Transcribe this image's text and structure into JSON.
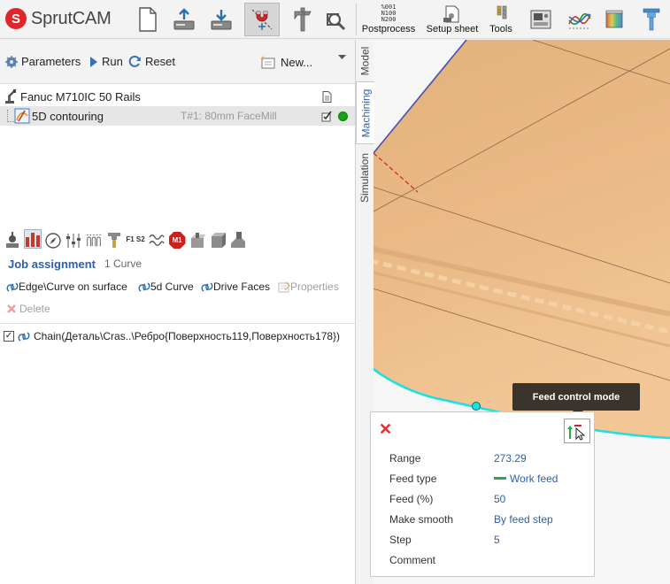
{
  "app": {
    "logo_letter": "S",
    "logo_text": "SprutCAM",
    "brand_color": "#e0262b"
  },
  "toolbar": {
    "postprocess_label": "Postprocess",
    "postprocess_icon_text": [
      "%001",
      "N100",
      "N200"
    ],
    "setup_sheet_label": "Setup sheet",
    "tools_label": "Tools"
  },
  "actions": {
    "parameters": "Parameters",
    "run": "Run",
    "reset": "Reset",
    "new": "New..."
  },
  "tree": {
    "machine": "Fanuc M710IC 50 Rails",
    "operation": "5D contouring",
    "operation_tool": "T#1: 80mm FaceMill",
    "operation_status_color": "#1aa31a"
  },
  "iconstrip": {
    "m1_label": "M1",
    "f1s2_label": "F1 S2"
  },
  "job": {
    "title": "Job assignment",
    "count": "1 Curve",
    "edge_curve": "Edge\\Curve on surface",
    "curve_5d": "5d Curve",
    "drive_faces": "Drive Faces",
    "properties": "Properties",
    "delete": "Delete",
    "chain": "Chain(Деталь\\Cras..\\Ребро{Поверхность119,Поверхность178})"
  },
  "tabs": {
    "model": "Model",
    "machining": "Machining",
    "simulation": "Simulation"
  },
  "tooltip": {
    "text": "Feed control mode"
  },
  "props": {
    "rows": [
      {
        "key": "Range",
        "value": "273.29"
      },
      {
        "key": "Feed type",
        "value": "Work feed"
      },
      {
        "key": "Feed (%)",
        "value": "50"
      },
      {
        "key": "Make smooth",
        "value": "By feed step"
      },
      {
        "key": "Step",
        "value": "5"
      },
      {
        "key": "Comment",
        "value": ""
      }
    ]
  }
}
